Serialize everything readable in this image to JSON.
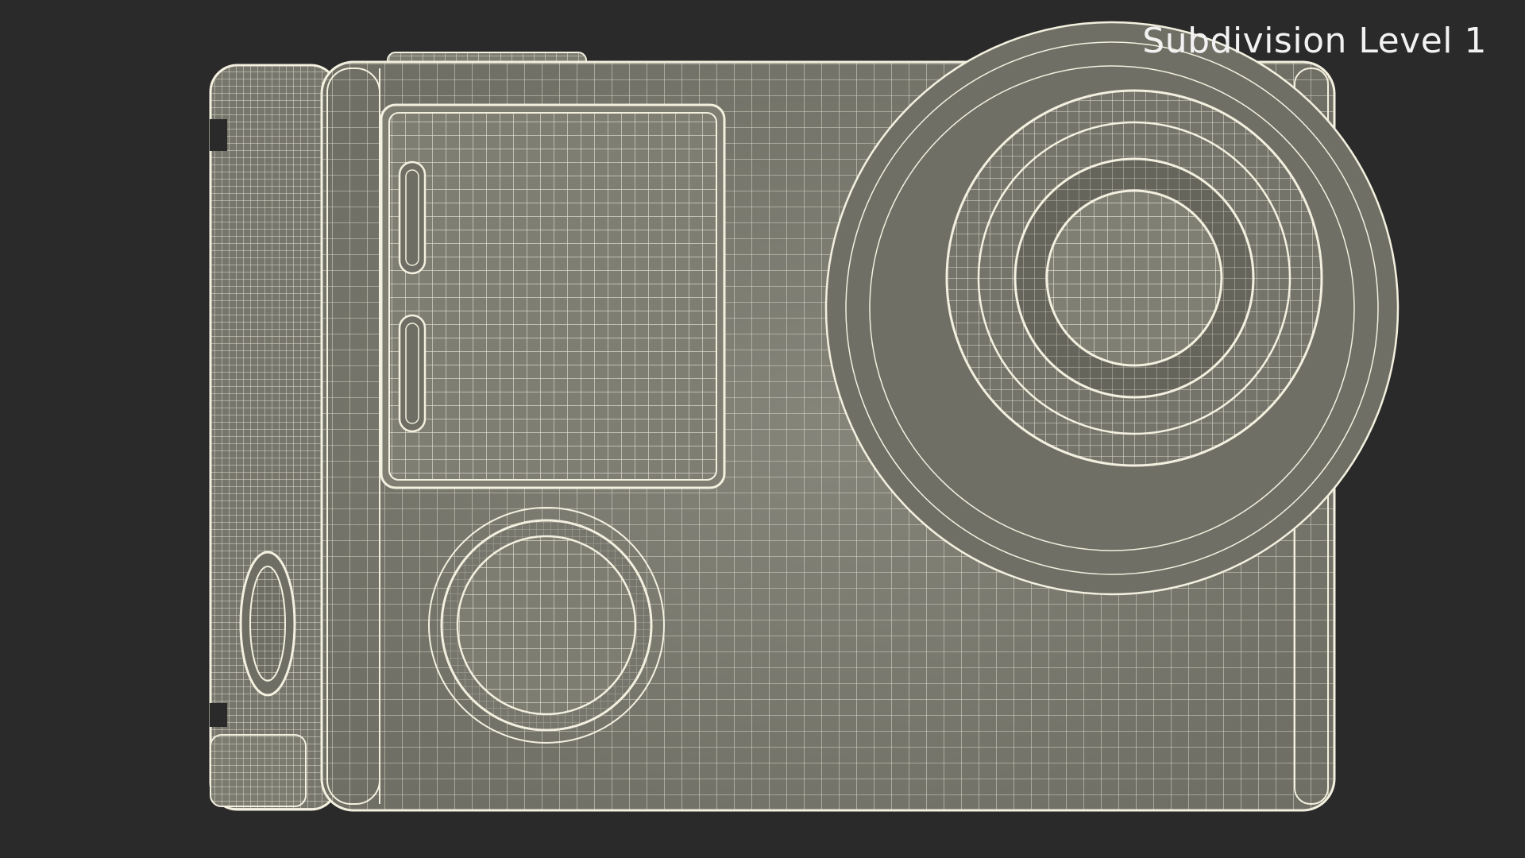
{
  "viewport_label": "Subdivision Level 1",
  "colors": {
    "background": "#2a2a2a",
    "surface": "#7b7b70",
    "surface_dark": "#6c6c62",
    "wire": "#f3f0df",
    "label": "#f2f2f2"
  },
  "subject": {
    "name": "action-camera-wireframe"
  }
}
